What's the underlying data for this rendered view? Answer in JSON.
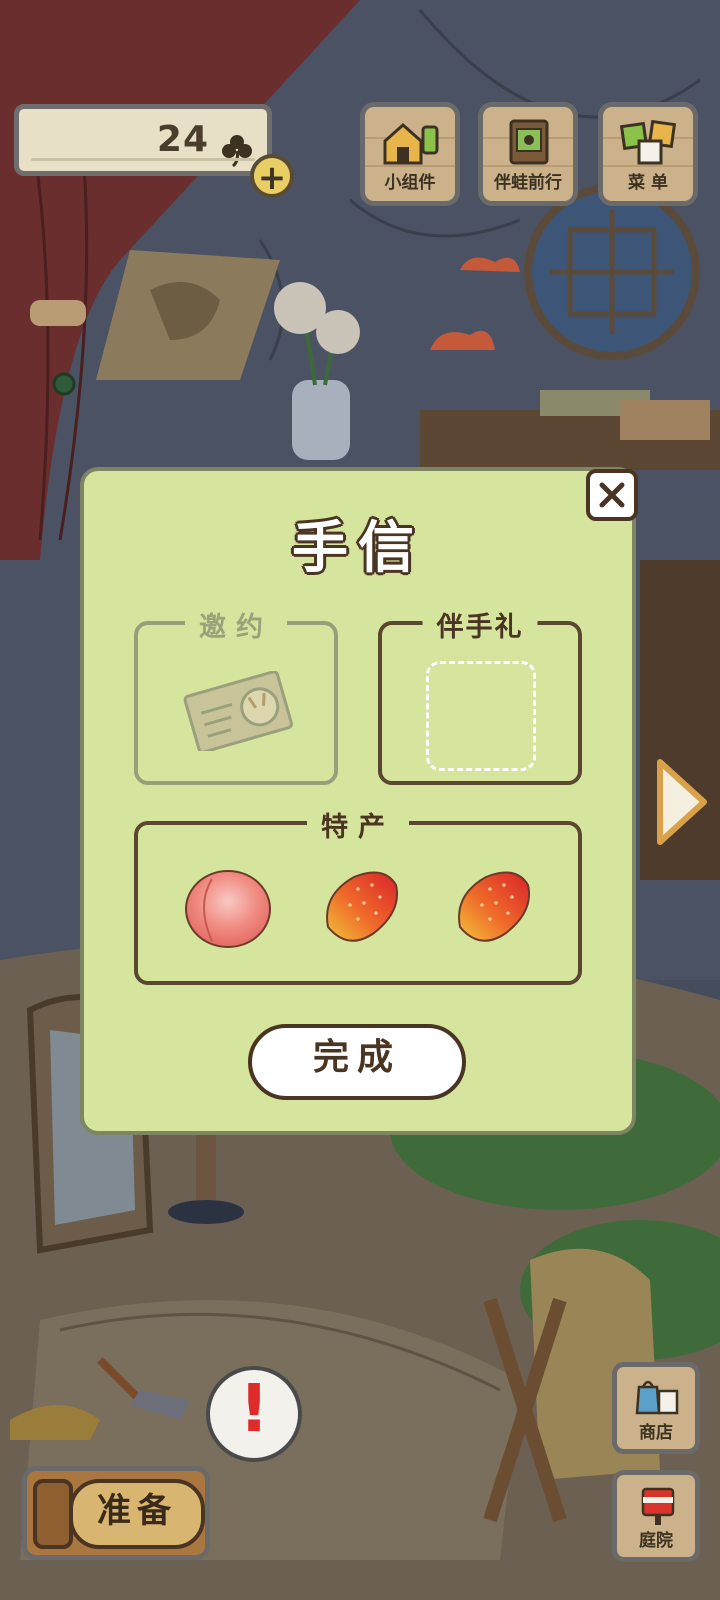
{
  "hud": {
    "clover_count": "24",
    "widgets_label": "小组件",
    "travel_label": "伴蛙前行",
    "menu_label": "菜 单",
    "shop_label": "商店",
    "garden_label": "庭院",
    "prepare_label": "准备",
    "alert_mark": "!"
  },
  "dialog": {
    "title": "手信",
    "invitation_label": "邀约",
    "gift_label": "伴手礼",
    "specialty_label": "特产",
    "specialty_items": [
      "peach-icon",
      "mango-icon",
      "mango-icon"
    ],
    "finish_label": "完成"
  },
  "colors": {
    "dialog_bg": "#d6e59e",
    "dialog_text": "#4a3422",
    "wood_button": "#cbb28a",
    "alert_red": "#e02b2b"
  }
}
